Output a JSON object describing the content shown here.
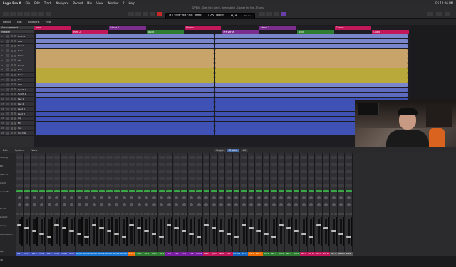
{
  "menubar": {
    "app": "Logic Pro X",
    "items": [
      "File",
      "Edit",
      "Track",
      "Navigate",
      "Record",
      "Mix",
      "View",
      "Window",
      "?",
      "Help"
    ],
    "clock": "Fri 12:26 PM"
  },
  "window": {
    "title": "DVB00 - Step Into Lie (ft. Rammstein) - Darker Pro Mix - Tracks"
  },
  "lcd": {
    "position": "01:00:00:00.000",
    "bars": "1 1 1 1",
    "bars2": "1 1 1 1",
    "tempo": "125.0000",
    "signature": "4/4",
    "sig_sub": "117",
    "key": "No In",
    "key2": "No Out"
  },
  "toolbar": {
    "items": [
      "Region",
      "Edit",
      "Functions",
      "View"
    ]
  },
  "tracklist": {
    "header": "Arrangement",
    "sub": "Marker",
    "tracks": [
      {
        "num": "1",
        "name": "Drums"
      },
      {
        "num": "2",
        "name": "Kick"
      },
      {
        "num": "3",
        "name": "Snare"
      },
      {
        "num": "4",
        "name": "Hats"
      },
      {
        "num": "5",
        "name": "Toms"
      },
      {
        "num": "6",
        "name": "OH"
      },
      {
        "num": "7",
        "name": "Room"
      },
      {
        "num": "8",
        "name": "Perc"
      },
      {
        "num": "9",
        "name": "Bass"
      },
      {
        "num": "10",
        "name": "Sub"
      },
      {
        "num": "11",
        "name": "808"
      },
      {
        "num": "12",
        "name": "Synth 1"
      },
      {
        "num": "13",
        "name": "Synth 2"
      },
      {
        "num": "14",
        "name": "Pad 1"
      },
      {
        "num": "15",
        "name": "Pad 2"
      },
      {
        "num": "16",
        "name": "Lead 1"
      },
      {
        "num": "17",
        "name": "Lead 2"
      },
      {
        "num": "18",
        "name": "Arp"
      },
      {
        "num": "19",
        "name": "FX"
      },
      {
        "num": "20",
        "name": "Vox"
      },
      {
        "num": "21",
        "name": "Vox Dbl"
      }
    ]
  },
  "markers": [
    {
      "label": "Intro",
      "color": "#c2185b"
    },
    {
      "label": "Intro 2",
      "color": "#c2185b"
    },
    {
      "label": "Verse 1",
      "color": "#7b2d8e"
    },
    {
      "label": "Build",
      "color": "#2e7d32"
    },
    {
      "label": "Chorus",
      "color": "#c2185b"
    },
    {
      "label": "Pre verse",
      "color": "#7b2d8e"
    },
    {
      "label": "Verse 2",
      "color": "#7b2d8e"
    },
    {
      "label": "Build",
      "color": "#2e7d32"
    },
    {
      "label": "Chorus",
      "color": "#c2185b"
    },
    {
      "label": "Outro",
      "color": "#c2185b"
    }
  ],
  "mixer_bar": {
    "items": [
      "Edit",
      "Options",
      "View"
    ],
    "tabs": [
      "Single",
      "Tracks",
      "All"
    ],
    "active_tab": "Tracks"
  },
  "mixer": {
    "row_labels": [
      "Setting",
      "EQ",
      "MIDI FX",
      "Input",
      "Audio FX",
      "",
      "Sends",
      "Output",
      "Group",
      "Automation",
      "",
      "Pan",
      "dB"
    ],
    "strips": [
      {
        "name": "Pad 1",
        "color": "#3f51b5"
      },
      {
        "name": "Pad 2",
        "color": "#3f51b5"
      },
      {
        "name": "Pad 3",
        "color": "#3f51b5"
      },
      {
        "name": "Pad 4",
        "color": "#3f51b5"
      },
      {
        "name": "Pad 5",
        "color": "#3f51b5"
      },
      {
        "name": "Pad 6",
        "color": "#3f51b5"
      },
      {
        "name": "PIANO",
        "color": "#3f51b5"
      },
      {
        "name": "Synth",
        "color": "#3f51b5"
      },
      {
        "name": "GUITAR 1",
        "color": "#1976d2"
      },
      {
        "name": "GUITAR 2",
        "color": "#1976d2"
      },
      {
        "name": "GUITAR 3",
        "color": "#1976d2"
      },
      {
        "name": "GUITAR 4",
        "color": "#1976d2"
      },
      {
        "name": "GUITAR 5",
        "color": "#1976d2"
      },
      {
        "name": "GUITAR 6",
        "color": "#1976d2"
      },
      {
        "name": "GUITAR 7",
        "color": "#1976d2"
      },
      {
        "name": "GTR FX",
        "color": "#ef6c00"
      },
      {
        "name": "Vox 1",
        "color": "#2e7d32"
      },
      {
        "name": "Vox 2",
        "color": "#2e7d32"
      },
      {
        "name": "Vox 3",
        "color": "#2e7d32"
      },
      {
        "name": "Vox 4",
        "color": "#2e7d32"
      },
      {
        "name": "FX 1",
        "color": "#7b1fa2"
      },
      {
        "name": "FX 2",
        "color": "#7b1fa2"
      },
      {
        "name": "FX 3",
        "color": "#7b1fa2"
      },
      {
        "name": "FX 4",
        "color": "#7b1fa2"
      },
      {
        "name": "Drums",
        "color": "#7b1fa2"
      },
      {
        "name": "Bass",
        "color": "#c2185b"
      },
      {
        "name": "Synth",
        "color": "#c2185b"
      },
      {
        "name": "Heads",
        "color": "#c2185b"
      },
      {
        "name": "Vox",
        "color": "#c2185b"
      },
      {
        "name": "VCA BUS",
        "color": "#1565c0"
      },
      {
        "name": "Bus 1",
        "color": "#1565c0"
      },
      {
        "name": "Bus 2",
        "color": "#ef6c00"
      },
      {
        "name": "Bus 3",
        "color": "#ef6c00"
      },
      {
        "name": "Bus 4",
        "color": "#2e7d32"
      },
      {
        "name": "Bus 5",
        "color": "#2e7d32"
      },
      {
        "name": "Bus 6",
        "color": "#2e7d32"
      },
      {
        "name": "Bus 7",
        "color": "#2e7d32"
      },
      {
        "name": "Bus 8",
        "color": "#2e7d32"
      },
      {
        "name": "Bus 9",
        "color": "#c2185b"
      },
      {
        "name": "Bus 10",
        "color": "#c2185b"
      },
      {
        "name": "Bus 11",
        "color": "#c2185b"
      },
      {
        "name": "Bus 12",
        "color": "#c2185b"
      },
      {
        "name": "Bus 13",
        "color": "#555"
      },
      {
        "name": "Stereo Out",
        "color": "#555"
      },
      {
        "name": "Master",
        "color": "#555"
      }
    ],
    "footer": "Bnc"
  }
}
